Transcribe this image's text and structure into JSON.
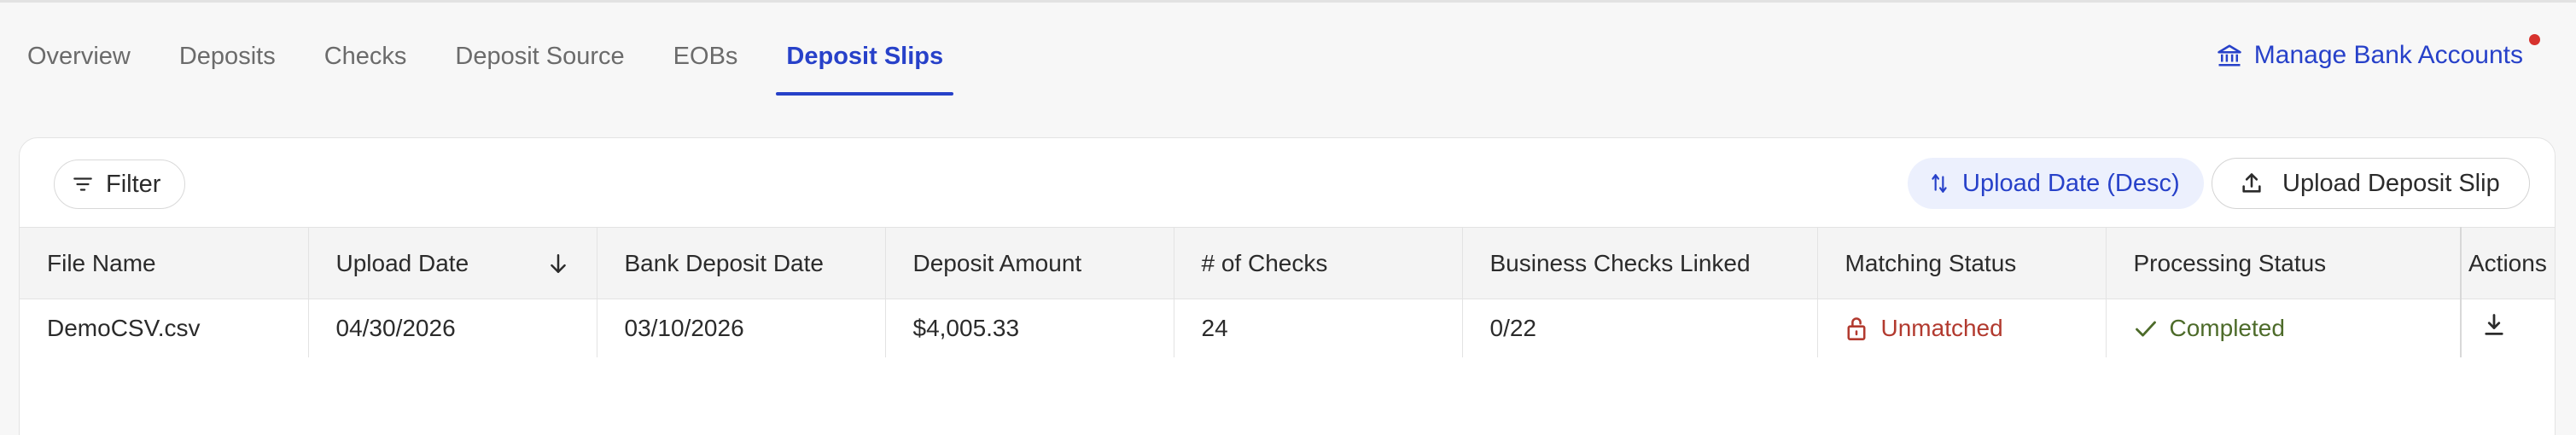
{
  "tabs": [
    {
      "label": "Overview",
      "active": false
    },
    {
      "label": "Deposits",
      "active": false
    },
    {
      "label": "Checks",
      "active": false
    },
    {
      "label": "Deposit Source",
      "active": false
    },
    {
      "label": "EOBs",
      "active": false
    },
    {
      "label": "Deposit Slips",
      "active": true
    }
  ],
  "header": {
    "manage_bank_accounts": "Manage Bank Accounts",
    "manage_icon": "bank-icon"
  },
  "toolbar": {
    "filter_label": "Filter",
    "sort_label": "Upload Date (Desc)",
    "upload_label": "Upload Deposit Slip"
  },
  "table": {
    "columns": [
      "File Name",
      "Upload Date",
      "Bank Deposit Date",
      "Deposit Amount",
      "# of Checks",
      "Business Checks Linked",
      "Matching Status",
      "Processing Status",
      "Actions"
    ],
    "rows": [
      {
        "file_name": "DemoCSV.csv",
        "upload_date": "04/30/2026",
        "bank_deposit_date": "03/10/2026",
        "deposit_amount": "$4,005.33",
        "num_checks": "24",
        "business_checks_linked": "0/22",
        "matching_status": "Unmatched",
        "processing_status": "Completed"
      }
    ]
  },
  "colors": {
    "accent": "#2741c9",
    "unmatched": "#b23a2f",
    "completed": "#4d6b2a",
    "notification_dot": "#d7322d"
  }
}
